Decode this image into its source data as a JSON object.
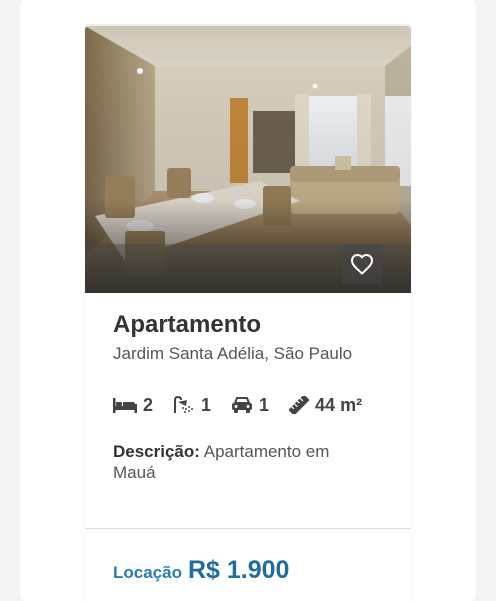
{
  "listing": {
    "type": "Apartamento",
    "location": "Jardim Santa Adélia, São Paulo",
    "features": {
      "bedrooms": "2",
      "bathrooms": "1",
      "parking": "1",
      "area": "44 m²"
    },
    "description_label": "Descrição:",
    "description_text": "Apartamento em Mauá",
    "price_label": "Locação",
    "price_value": "R$ 1.900",
    "favorite_icon": "heart-outline-icon",
    "colors": {
      "accent": "#1f6d9e",
      "text": "#333333"
    }
  }
}
